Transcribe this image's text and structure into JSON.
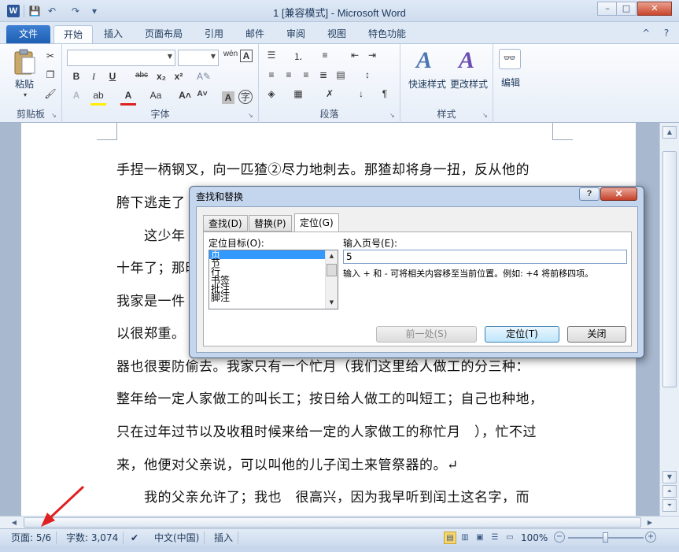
{
  "window": {
    "title": "1 [兼容模式] - Microsoft Word",
    "app_icon_letter": "W",
    "controls": {
      "minimize": "–",
      "maximize": "□",
      "close": "✕"
    }
  },
  "quick_access": {
    "save": "💾",
    "undo": "↶",
    "redo": "↷",
    "customize": "▾"
  },
  "ribbon_tabs": [
    "文件",
    "开始",
    "插入",
    "页面布局",
    "引用",
    "邮件",
    "审阅",
    "视图",
    "特色功能"
  ],
  "ribbon_tab_extras": {
    "minimize": "^",
    "help": "?"
  },
  "ribbon": {
    "clipboard": {
      "label": "剪贴板",
      "paste": "粘贴"
    },
    "font": {
      "label": "字体",
      "font_name": "",
      "font_size": ""
    },
    "paragraph": {
      "label": "段落"
    },
    "styles": {
      "label": "样式",
      "quick_styles": "快速样式",
      "change_styles": "更改样式"
    },
    "editing": {
      "label": "编辑"
    }
  },
  "document": {
    "lines": [
      "手捏一柄钢叉，向一匹猹②尽力地刺去。那猹却将身一扭，反从他的",
      "胯下逃走了",
      "　　这少年",
      "十年了；那时",
      "我家是一件",
      "以很郑重。",
      "器也很要防偷去。我家只有一个忙月（我们这里给人做工的分三种：",
      "整年给一定人家做工的叫长工；按日给人做工的叫短工；自己也种地，",
      "只在过年过节以及收租时候来给一定的人家做工的称忙月　），忙不过",
      "来，他便对父亲说，可以叫他的儿子闰土来管祭器的。↵",
      "　　我的父亲允许了；我也　很高兴，因为我早听到闰土这名字，而"
    ]
  },
  "dialog": {
    "title": "查找和替换",
    "help": "?",
    "close": "✕",
    "tabs": [
      "查找(D)",
      "替换(P)",
      "定位(G)"
    ],
    "active_tab": "定位(G)",
    "goto_what_label": "定位目标(O):",
    "goto_what_items": [
      "页",
      "节",
      "行",
      "书签",
      "批注",
      "脚注"
    ],
    "goto_what_selected": "页",
    "page_number_label": "输入页号(E):",
    "page_number_value": "5",
    "hint": "输入 + 和 - 可将相关内容移至当前位置。例如: +4 将前移四项。",
    "buttons": {
      "previous": "前一处(S)",
      "goto": "定位(T)",
      "close": "关闭"
    }
  },
  "status_bar": {
    "page": "页面: 5/6",
    "words": "字数: 3,074",
    "language": "中文(中国)",
    "mode": "插入",
    "zoom": "100%"
  },
  "colors": {
    "accent": "#2b579a",
    "annotation_arrow": "#e02020",
    "selection": "#3399ff"
  }
}
